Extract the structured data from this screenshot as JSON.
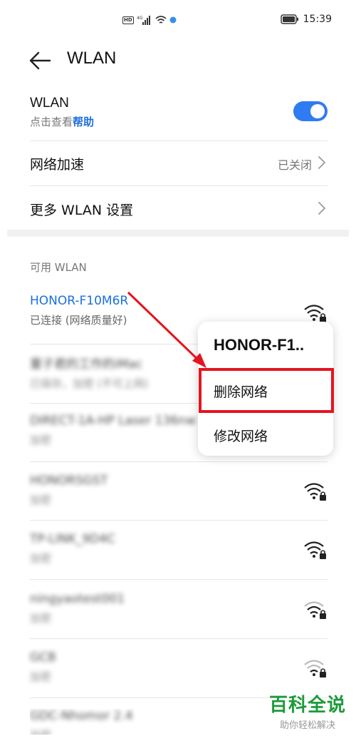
{
  "status_bar": {
    "hd": "HD",
    "network": "4G",
    "time": "15:39"
  },
  "app_bar": {
    "title": "WLAN"
  },
  "wlan_toggle": {
    "label": "WLAN",
    "hint_prefix": "点击查看",
    "help_link": "帮助",
    "enabled": true
  },
  "network_accel": {
    "label": "网络加速",
    "value": "已关闭"
  },
  "more_settings": {
    "label": "更多 WLAN 设置"
  },
  "available": {
    "header": "可用 WLAN",
    "networks": [
      {
        "name": "HONOR-F10M6R",
        "status": "已连接 (网络质量好)",
        "connected": true
      },
      {
        "name": "董子君的工作的iMac",
        "status": "已保存，加密 (不可上网)",
        "connected": false
      },
      {
        "name": "DIRECT-1A-HP Laser 136nw",
        "status": "加密",
        "connected": false
      },
      {
        "name": "HONORSGST",
        "status": "加密",
        "connected": false
      },
      {
        "name": "TP-LINK_9D4C",
        "status": "加密",
        "connected": false
      },
      {
        "name": "ningyaotest001",
        "status": "加密",
        "connected": false
      },
      {
        "name": "GCB",
        "status": "加密",
        "connected": false
      },
      {
        "name": "GDC-Nhomor 2.4",
        "status": "加密",
        "connected": false
      }
    ]
  },
  "context_menu": {
    "title": "HONOR-F1..",
    "delete": "删除网络",
    "modify": "修改网络"
  },
  "watermark": {
    "title": "百科全说",
    "subtitle": "助你轻松解决"
  },
  "colors": {
    "accent": "#2f7bf2",
    "link": "#1a6fe0",
    "highlight": "#e5141e",
    "watermark": "#1d9a3a"
  }
}
